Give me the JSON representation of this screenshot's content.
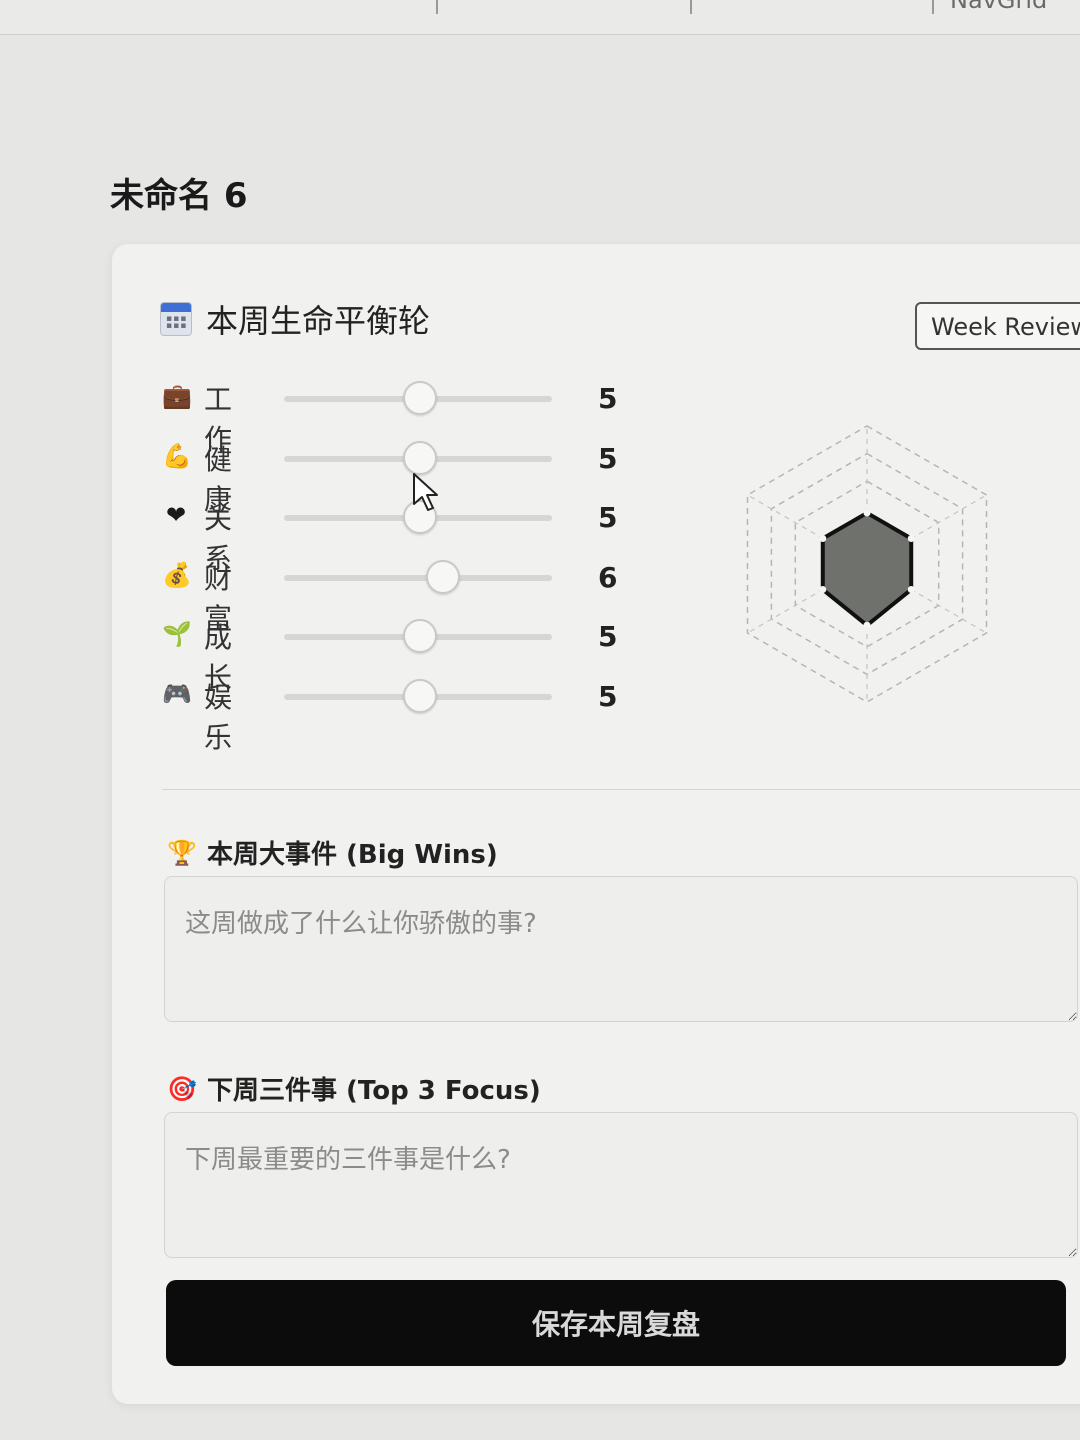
{
  "nav": {
    "items": [
      "",
      "",
      "NavGrid"
    ]
  },
  "page": {
    "title": "未命名 6"
  },
  "card": {
    "title": "本周生命平衡轮",
    "title_icon": "calendar-icon",
    "week_review_label": "Week Review"
  },
  "dimensions": [
    {
      "label": "工作",
      "value": 5,
      "icon": "briefcase-icon",
      "glyph": "💼"
    },
    {
      "label": "健康",
      "value": 5,
      "icon": "flexed-biceps-icon",
      "glyph": "💪"
    },
    {
      "label": "关系",
      "value": 5,
      "icon": "heart-icon",
      "glyph": "❤"
    },
    {
      "label": "财富",
      "value": 6,
      "icon": "money-bag-icon",
      "glyph": "💰"
    },
    {
      "label": "成长",
      "value": 5,
      "icon": "seedling-icon",
      "glyph": "🌱"
    },
    {
      "label": "娱乐",
      "value": 5,
      "icon": "game-controller-icon",
      "glyph": "🎮"
    }
  ],
  "slider": {
    "min": 0,
    "max": 10
  },
  "big_wins": {
    "label": "本周大事件 (Big Wins)",
    "icon": "trophy-icon",
    "glyph": "🏆",
    "placeholder": "这周做成了什么让你骄傲的事?"
  },
  "top3": {
    "label": "下周三件事 (Top 3 Focus)",
    "icon": "target-icon",
    "glyph": "🎯",
    "placeholder": "下周最重要的三件事是什么?"
  },
  "save_label": "保存本周复盘",
  "colors": {
    "radar_fill": "#6f716c",
    "radar_stroke": "#111111",
    "accent_button": "#0c0c0c"
  }
}
